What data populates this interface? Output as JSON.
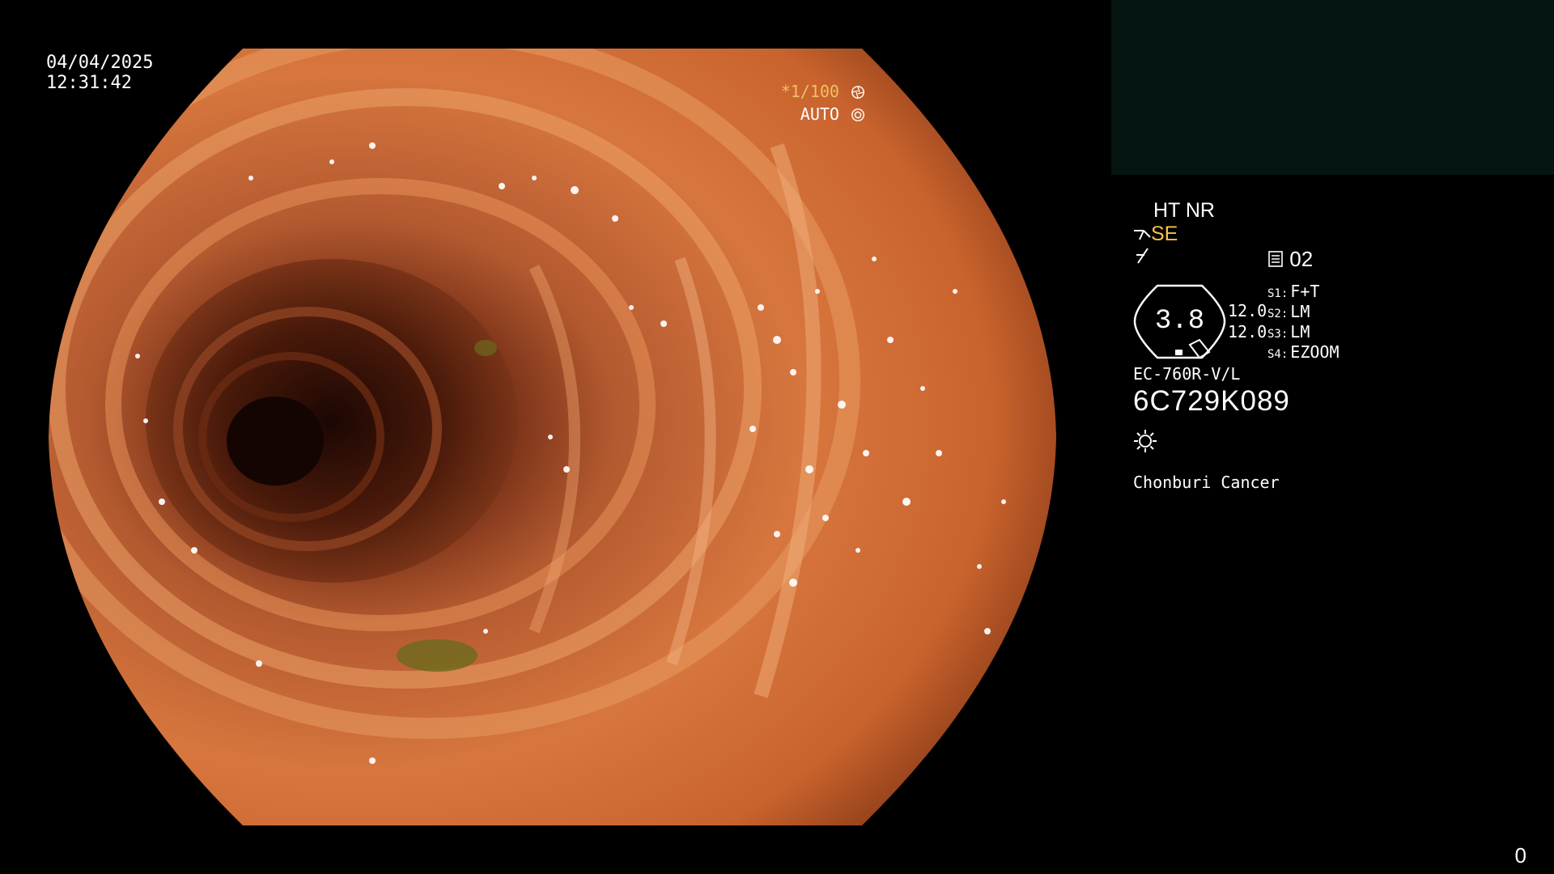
{
  "datetime": {
    "date": "04/04/2025",
    "time": "12:31:42"
  },
  "exposure": {
    "shutter": "*1/100",
    "iris": "AUTO"
  },
  "image_settings": {
    "enhancement": "HT NR",
    "structure_mode": "SE",
    "memory_slot": "02"
  },
  "gauge": {
    "value": "3.8",
    "side_top": "12.0",
    "side_bottom": "12.0"
  },
  "switches": [
    {
      "key": "S1:",
      "value": "F+T"
    },
    {
      "key": "S2:",
      "value": "LM"
    },
    {
      "key": "S3:",
      "value": "LM"
    },
    {
      "key": "S4:",
      "value": "EZOOM"
    }
  ],
  "scope": {
    "model": "EC-760R-V/L",
    "serial": "6C729K089"
  },
  "institution": "Chonburi Cancer",
  "counter": "0",
  "icons": [
    "iris-icon",
    "auto-exposure-icon",
    "structure-mode-icon",
    "edge-icon",
    "memory-icon",
    "light-source-icon"
  ],
  "colors": {
    "background": "#000000",
    "accent": "#f5c242",
    "thumb_panel": "#051511",
    "mucosa": "#d7763e"
  }
}
